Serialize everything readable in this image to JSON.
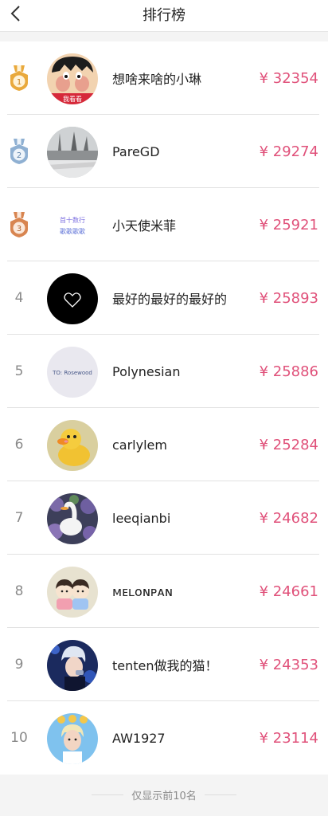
{
  "header": {
    "title": "排行榜",
    "back_icon": "chevron-left-icon"
  },
  "colors": {
    "amount": "#e0517a",
    "gold": "#e9a93c",
    "silver": "#8fb0d2",
    "bronze": "#d88550"
  },
  "ranking": [
    {
      "rank": "1",
      "medal": "gold",
      "name": "想啥来啥的小琳",
      "amount": "¥ 32354",
      "avatar_text": "我看看"
    },
    {
      "rank": "2",
      "medal": "silver",
      "name": "PareGD",
      "amount": "¥ 29274"
    },
    {
      "rank": "3",
      "medal": "bronze",
      "name": "小天使米菲",
      "amount": "¥ 25921",
      "avatar_text_1": "首十数行",
      "avatar_text_2": "歌歌歌歌"
    },
    {
      "rank": "4",
      "name": "最好的最好的最好的",
      "amount": "¥ 25893"
    },
    {
      "rank": "5",
      "name": "Polynesian",
      "amount": "¥ 25886",
      "avatar_text": "TO: Rosewood"
    },
    {
      "rank": "6",
      "name": "carlylem",
      "amount": "¥ 25284"
    },
    {
      "rank": "7",
      "name": "leeqianbi",
      "amount": "¥ 24682"
    },
    {
      "rank": "8",
      "name": "ᴍᴇʟᴏɴᴘᴀɴ",
      "amount": "¥ 24661"
    },
    {
      "rank": "9",
      "name": "tenten做我的猫！",
      "amount": "¥ 24353"
    },
    {
      "rank": "10",
      "name": "AW1927",
      "amount": "¥ 23114"
    }
  ],
  "footer": {
    "note": "仅显示前10名"
  }
}
